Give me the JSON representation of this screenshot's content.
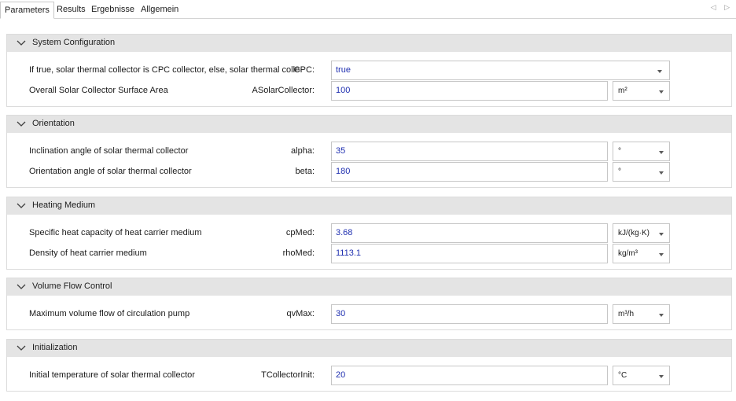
{
  "tabs": [
    {
      "label": "Parameters",
      "active": true
    },
    {
      "label": "Results",
      "active": false
    },
    {
      "label": "Ergebnisse",
      "active": false
    },
    {
      "label": "Allgemein",
      "active": false
    }
  ],
  "tab_arrows": "◁ ▷",
  "sections": [
    {
      "title": "System Configuration",
      "rows": [
        {
          "label": "If true, solar thermal collector is CPC collector, else, solar thermal collec...",
          "var": "CPC:",
          "value": "true",
          "unit": ""
        },
        {
          "label": "Overall Solar Collector Surface Area",
          "var": "ASolarCollector:",
          "value": "100",
          "unit": "m²"
        }
      ]
    },
    {
      "title": "Orientation",
      "rows": [
        {
          "label": "Inclination angle of solar thermal collector",
          "var": "alpha:",
          "value": "35",
          "unit": "°"
        },
        {
          "label": "Orientation angle of solar thermal collector",
          "var": "beta:",
          "value": "180",
          "unit": "°"
        }
      ]
    },
    {
      "title": "Heating Medium",
      "rows": [
        {
          "label": "Specific heat capacity of heat carrier medium",
          "var": "cpMed:",
          "value": "3.68",
          "unit": "kJ/(kg·K)"
        },
        {
          "label": "Density of heat carrier medium",
          "var": "rhoMed:",
          "value": "1113.1",
          "unit": "kg/m³"
        }
      ]
    },
    {
      "title": "Volume Flow Control",
      "rows": [
        {
          "label": "Maximum volume flow of circulation pump",
          "var": "qvMax:",
          "value": "30",
          "unit": "m³/h"
        }
      ]
    },
    {
      "title": "Initialization",
      "rows": [
        {
          "label": "Initial temperature of solar thermal collector",
          "var": "TCollectorInit:",
          "value": "20",
          "unit": "°C"
        }
      ]
    }
  ]
}
